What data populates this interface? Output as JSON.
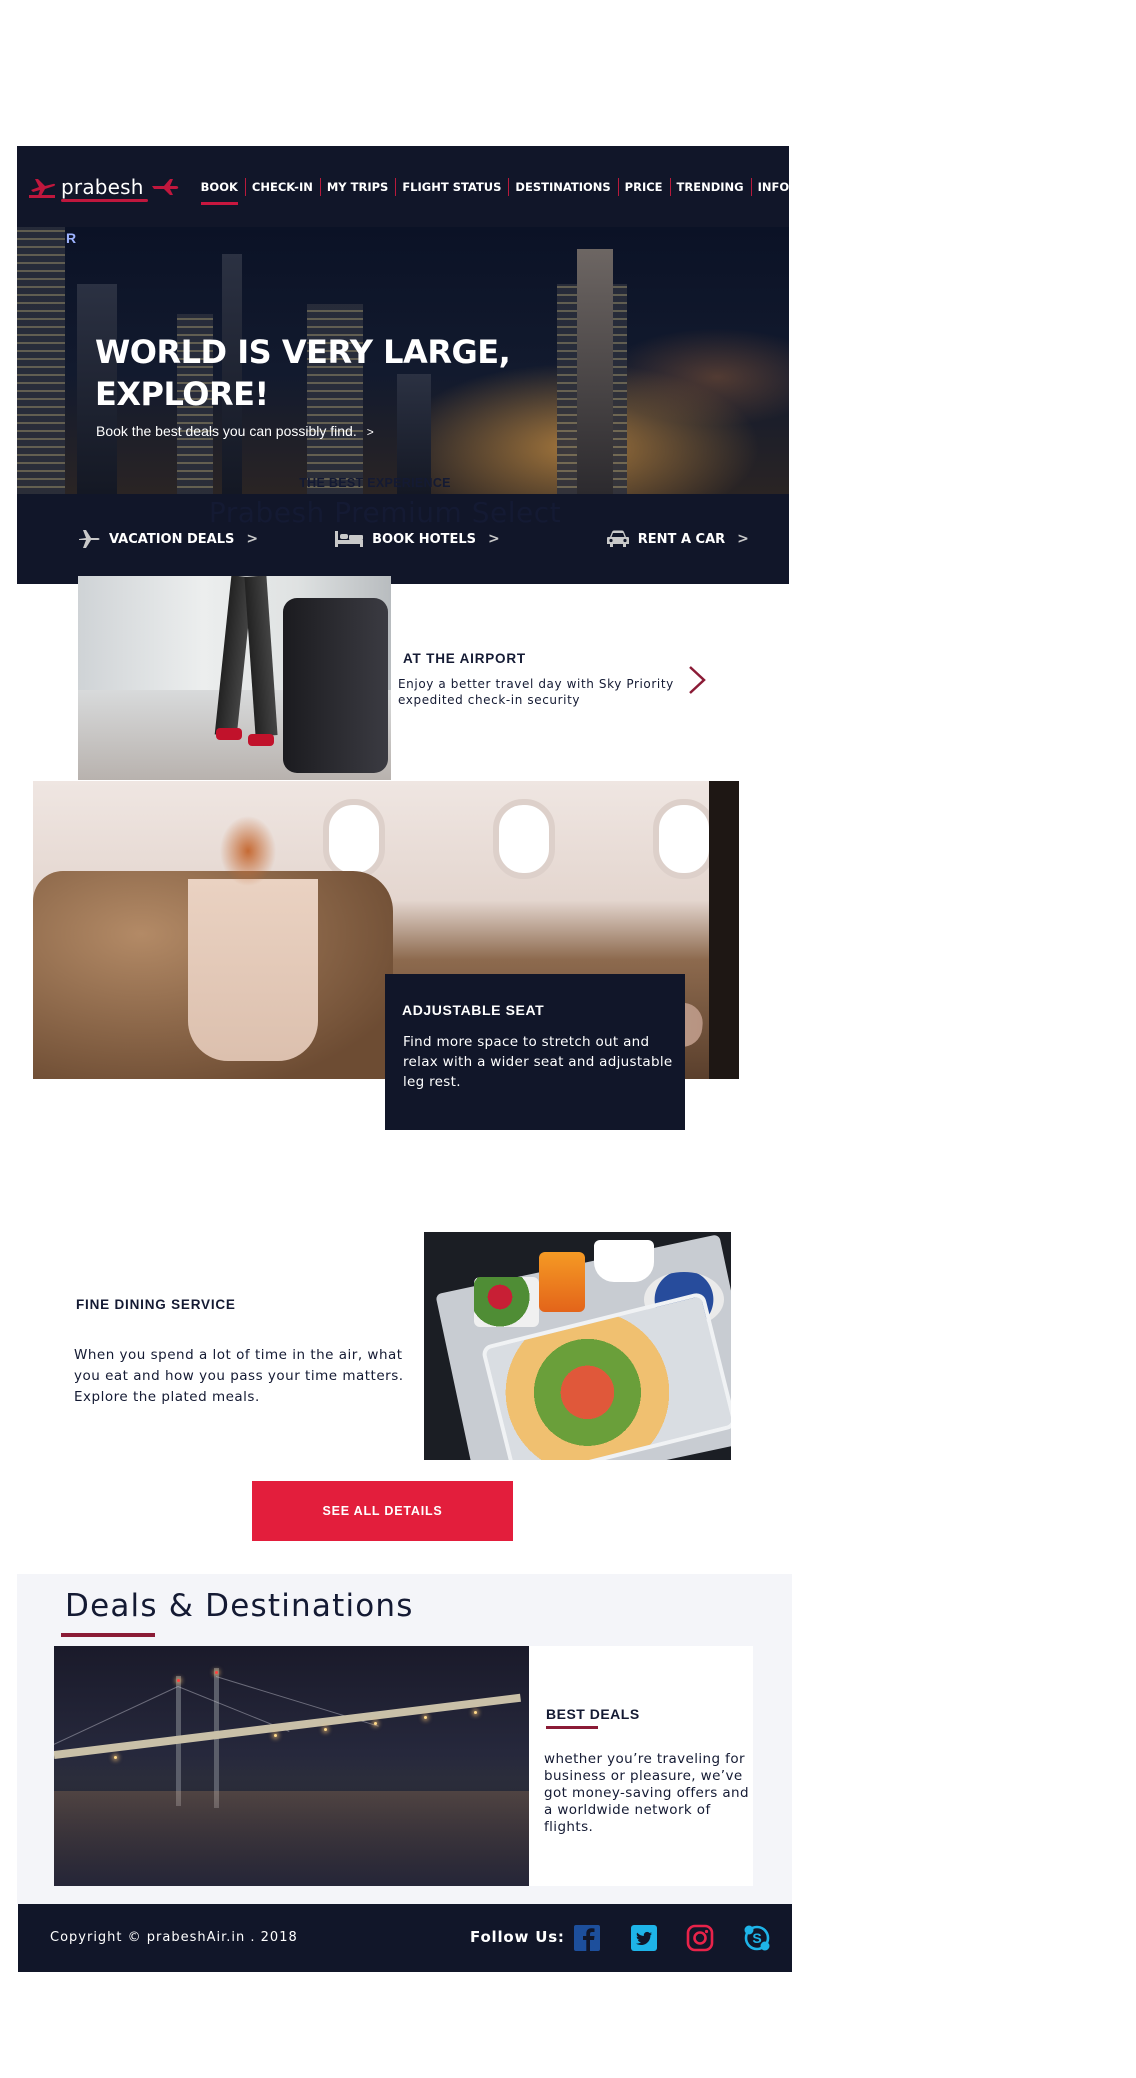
{
  "header": {
    "logo_text": "prabesh",
    "nav": [
      {
        "label": "BOOK",
        "active": true
      },
      {
        "label": "CHECK-IN"
      },
      {
        "label": "MY TRIPS"
      },
      {
        "label": "FLIGHT STATUS"
      },
      {
        "label": "DESTINATIONS"
      },
      {
        "label": "PRICE"
      },
      {
        "label": "TRENDING"
      },
      {
        "label": "INFO"
      }
    ]
  },
  "hero": {
    "title_line1": "WORLD IS VERY LARGE,",
    "title_line2": "EXPLORE!",
    "subtitle": "Book the best deals you can possibly find.",
    "subtitle_chevron": ">"
  },
  "quick_links": [
    {
      "label": "VACATION DEALS",
      "icon": "plane-icon",
      "arrow": ">"
    },
    {
      "label": "BOOK HOTELS",
      "icon": "bed-icon",
      "arrow": ">"
    },
    {
      "label": "RENT A CAR",
      "icon": "car-icon",
      "arrow": ">"
    }
  ],
  "premium": {
    "eyebrow": "THE BEST EXPERIENCE",
    "title": "Prabesh Premium Select"
  },
  "airport": {
    "title": "AT THE AIRPORT",
    "desc": "Enjoy a better travel day with Sky Priority expedited check-in security"
  },
  "seat": {
    "title": "ADJUSTABLE SEAT",
    "desc": "Find more space to stretch out and relax with a wider seat and adjustable leg rest."
  },
  "dining": {
    "title": "FINE DINING SERVICE",
    "desc": "When you spend a lot of time in the air, what you eat and how you pass your time matters. Explore the plated meals."
  },
  "see_all_label": "SEE ALL DETAILS",
  "deals": {
    "title": "Deals & Destinations",
    "card_title": "BEST DEALS",
    "card_desc": "whether you’re traveling for business or pleasure, we’ve got money-saving offers and a worldwide network of flights."
  },
  "footer": {
    "copyright": "Copyright © prabeshAir.in . 2018",
    "follow_label": "Follow Us:",
    "social": [
      "facebook-icon",
      "twitter-icon",
      "instagram-icon",
      "skype-icon"
    ]
  },
  "colors": {
    "navy": "#111629",
    "accent_red": "#e31e3c",
    "maroon": "#8b1b36",
    "light_bg": "#f4f5f9"
  }
}
